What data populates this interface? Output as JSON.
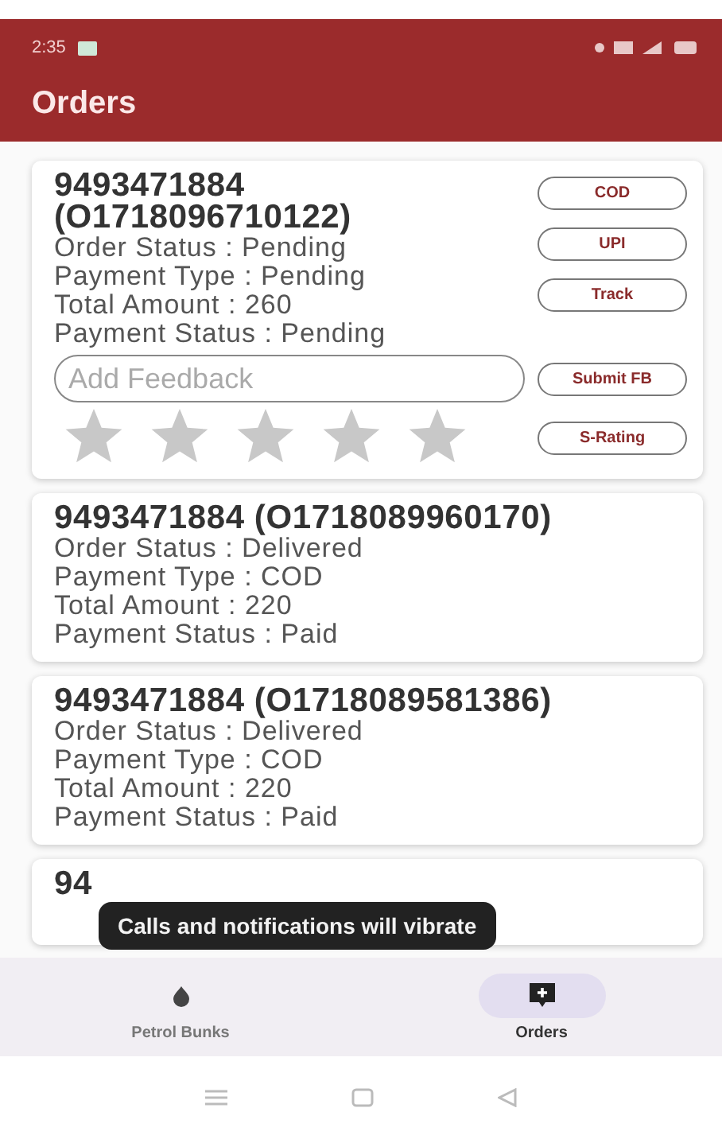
{
  "status_bar": {
    "time": "2:35"
  },
  "app_bar": {
    "title": "Orders"
  },
  "orders": [
    {
      "kind": "active",
      "title": "9493471884 (O1718096710122)",
      "lines": [
        "Order Status : Pending",
        "Payment Type : Pending",
        "Total Amount : 260",
        "Payment Status : Pending"
      ],
      "buttons": [
        "COD",
        "UPI",
        "Track"
      ],
      "feedback": {
        "placeholder": "Add Feedback",
        "button": "Submit FB"
      },
      "rating": {
        "stars": 0,
        "button": "S-Rating"
      }
    },
    {
      "kind": "plain",
      "title": "9493471884 (O1718089960170)",
      "lines": [
        "Order Status : Delivered",
        "Payment Type : COD",
        "Total Amount : 220",
        "Payment Status : Paid"
      ]
    },
    {
      "kind": "plain",
      "title": "9493471884 (O1718089581386)",
      "lines": [
        "Order Status : Delivered",
        "Payment Type : COD",
        "Total Amount : 220",
        "Payment Status : Paid"
      ]
    },
    {
      "kind": "partial",
      "title": "94"
    }
  ],
  "toast": "Calls and notifications will vibrate",
  "bottom_nav": [
    {
      "label": "Petrol Bunks",
      "kind": "bunk",
      "selected": false
    },
    {
      "label": "Orders",
      "kind": "orders",
      "selected": true
    }
  ]
}
